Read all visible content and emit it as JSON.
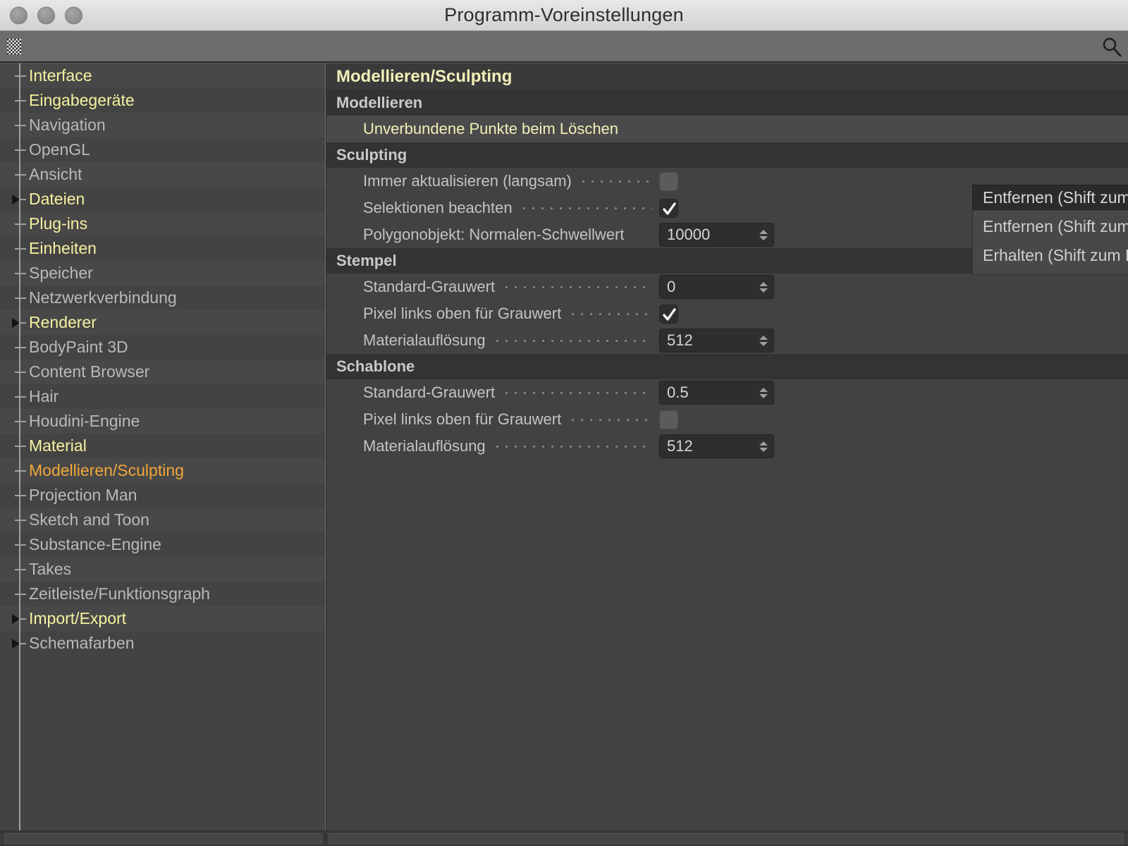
{
  "window": {
    "title": "Programm-Voreinstellungen",
    "traffic_lights": [
      "close",
      "minimize",
      "zoom"
    ]
  },
  "toolbar": {
    "grip_name": "drag-grip",
    "search_icon": "search-icon"
  },
  "sidebar": {
    "items": [
      {
        "label": "Interface",
        "kind": "folder",
        "arrow": false,
        "alt": true
      },
      {
        "label": "Eingabegeräte",
        "kind": "folder",
        "arrow": false,
        "alt": false
      },
      {
        "label": "Navigation",
        "kind": "plain",
        "arrow": false,
        "alt": true
      },
      {
        "label": "OpenGL",
        "kind": "plain",
        "arrow": false,
        "alt": false
      },
      {
        "label": "Ansicht",
        "kind": "plain",
        "arrow": false,
        "alt": true
      },
      {
        "label": "Dateien",
        "kind": "folder",
        "arrow": true,
        "alt": false
      },
      {
        "label": "Plug-ins",
        "kind": "folder",
        "arrow": false,
        "alt": true
      },
      {
        "label": "Einheiten",
        "kind": "folder",
        "arrow": false,
        "alt": false
      },
      {
        "label": "Speicher",
        "kind": "plain",
        "arrow": false,
        "alt": true
      },
      {
        "label": "Netzwerkverbindung",
        "kind": "plain",
        "arrow": false,
        "alt": false
      },
      {
        "label": "Renderer",
        "kind": "folder",
        "arrow": true,
        "alt": true
      },
      {
        "label": "BodyPaint 3D",
        "kind": "plain",
        "arrow": false,
        "alt": false
      },
      {
        "label": "Content Browser",
        "kind": "plain",
        "arrow": false,
        "alt": true
      },
      {
        "label": "Hair",
        "kind": "plain",
        "arrow": false,
        "alt": false
      },
      {
        "label": "Houdini-Engine",
        "kind": "plain",
        "arrow": false,
        "alt": true
      },
      {
        "label": "Material",
        "kind": "folder",
        "arrow": false,
        "alt": false
      },
      {
        "label": "Modellieren/Sculpting",
        "kind": "active",
        "arrow": false,
        "alt": true
      },
      {
        "label": "Projection Man",
        "kind": "plain",
        "arrow": false,
        "alt": false
      },
      {
        "label": "Sketch and Toon",
        "kind": "plain",
        "arrow": false,
        "alt": true
      },
      {
        "label": "Substance-Engine",
        "kind": "plain",
        "arrow": false,
        "alt": false
      },
      {
        "label": "Takes",
        "kind": "plain",
        "arrow": false,
        "alt": true
      },
      {
        "label": "Zeitleiste/Funktionsgraph",
        "kind": "plain",
        "arrow": false,
        "alt": false
      },
      {
        "label": "Import/Export",
        "kind": "folder",
        "arrow": true,
        "alt": true
      },
      {
        "label": "Schemafarben",
        "kind": "plain",
        "arrow": true,
        "alt": false
      }
    ]
  },
  "main": {
    "page_title": "Modellieren/Sculpting",
    "sections": [
      {
        "header": "Modellieren",
        "rows": [
          {
            "label": "Unverbundene Punkte beim Löschen",
            "control": "dropdown",
            "value": "Entfernen (Shift zum Erhalten)",
            "shaded": true,
            "highlight": true,
            "leader": false
          }
        ]
      },
      {
        "header": "Sculpting",
        "rows": [
          {
            "label": "Immer aktualisieren (langsam)",
            "control": "checkbox",
            "checked": false,
            "shaded": false,
            "highlight": false,
            "leader": true
          },
          {
            "label": "Selektionen beachten",
            "control": "checkbox",
            "checked": true,
            "shaded": false,
            "highlight": false,
            "leader": true
          },
          {
            "label": "Polygonobjekt: Normalen-Schwellwert",
            "control": "number",
            "value": "10000",
            "shaded": false,
            "highlight": false,
            "leader": false
          }
        ]
      },
      {
        "header": "Stempel",
        "rows": [
          {
            "label": "Standard-Grauwert",
            "control": "number",
            "value": "0",
            "shaded": false,
            "highlight": false,
            "leader": true
          },
          {
            "label": "Pixel links oben für Grauwert",
            "control": "checkbox",
            "checked": true,
            "shaded": false,
            "highlight": false,
            "leader": true
          },
          {
            "label": "Materialauflösung",
            "control": "number",
            "value": "512",
            "shaded": false,
            "highlight": false,
            "leader": true
          }
        ]
      },
      {
        "header": "Schablone",
        "rows": [
          {
            "label": "Standard-Grauwert",
            "control": "number",
            "value": "0.5",
            "shaded": false,
            "highlight": false,
            "leader": true
          },
          {
            "label": "Pixel links oben für Grauwert",
            "control": "checkbox",
            "checked": false,
            "shaded": false,
            "highlight": false,
            "leader": true
          },
          {
            "label": "Materialauflösung",
            "control": "number",
            "value": "512",
            "shaded": false,
            "highlight": false,
            "leader": true
          }
        ]
      }
    ]
  },
  "dropdown": {
    "open": true,
    "selected": "Entfernen (Shift zum Erhalten)",
    "options": [
      "Entfernen (Shift zum Erhalten)",
      "Erhalten (Shift zum Entfernen)"
    ]
  },
  "colors": {
    "folder_label": "#f5f2a0",
    "active_label": "#f0a73a",
    "plain_label": "#b9b9b9",
    "panel_bg": "#424242",
    "group_header_bg": "#333333",
    "titlebar_bg": "#dcdcdc",
    "toolbar_bg": "#6d6d6d"
  }
}
